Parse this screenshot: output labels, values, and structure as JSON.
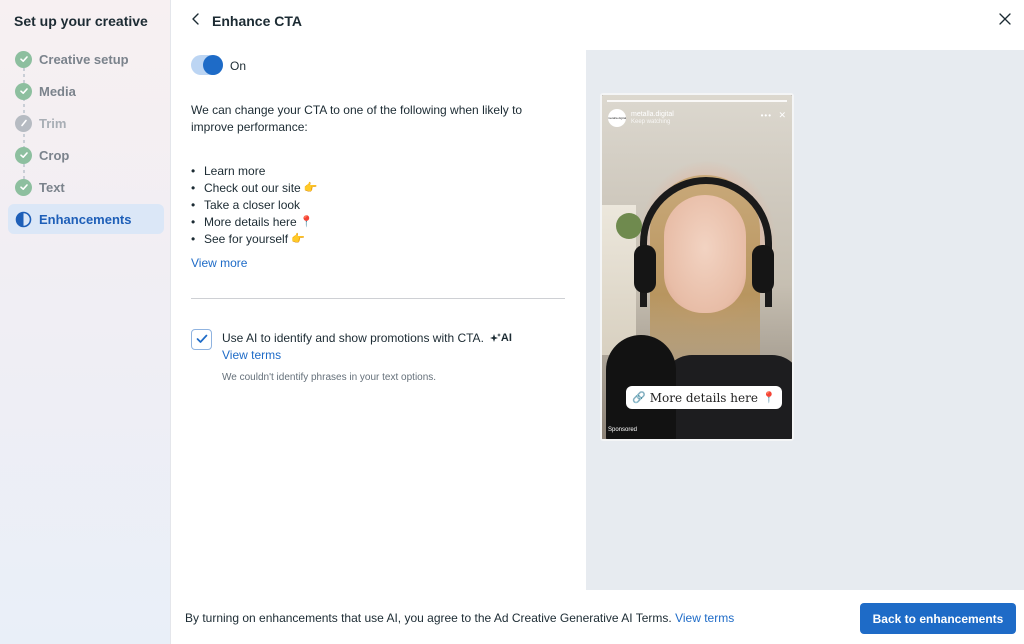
{
  "sidebar": {
    "title": "Set up your creative",
    "steps": [
      {
        "label": "Creative setup",
        "state": "done"
      },
      {
        "label": "Media",
        "state": "done"
      },
      {
        "label": "Trim",
        "state": "disabled"
      },
      {
        "label": "Crop",
        "state": "done"
      },
      {
        "label": "Text",
        "state": "done"
      },
      {
        "label": "Enhancements",
        "state": "active"
      }
    ]
  },
  "header": {
    "title": "Enhance CTA",
    "back_icon": "chevron-left-icon",
    "close_icon": "close-icon"
  },
  "toggle": {
    "label": "On",
    "state": "on"
  },
  "description": "We can change your CTA to one of the following when likely to improve performance:",
  "cta_options": [
    {
      "label": "Learn more",
      "emoji": ""
    },
    {
      "label": "Check out our site",
      "emoji": "👉"
    },
    {
      "label": "Take a closer look",
      "emoji": ""
    },
    {
      "label": "More details here",
      "emoji": "📍"
    },
    {
      "label": "See for yourself",
      "emoji": "👉"
    }
  ],
  "view_more": "View more",
  "ai_option": {
    "checked": true,
    "label": "Use AI to identify and show promotions with CTA.",
    "badge": "AI",
    "view_terms": "View terms",
    "note": "We couldn't identify phrases in your text options."
  },
  "preview": {
    "account_name": "metalla.digital",
    "account_sub": "Keep watching",
    "avatar_text": "metalla.digital",
    "cta_sticker": "More details here",
    "cta_emoji": "📍",
    "sponsored": "Sponsored"
  },
  "footer": {
    "text": "By turning on enhancements that use AI, you agree to the Ad Creative Generative AI Terms.",
    "link": "View terms",
    "button": "Back to enhancements"
  },
  "colors": {
    "accent": "#1e6bc7",
    "done_step": "#8dbf9f",
    "active_step_bg": "#dbe7f7"
  }
}
